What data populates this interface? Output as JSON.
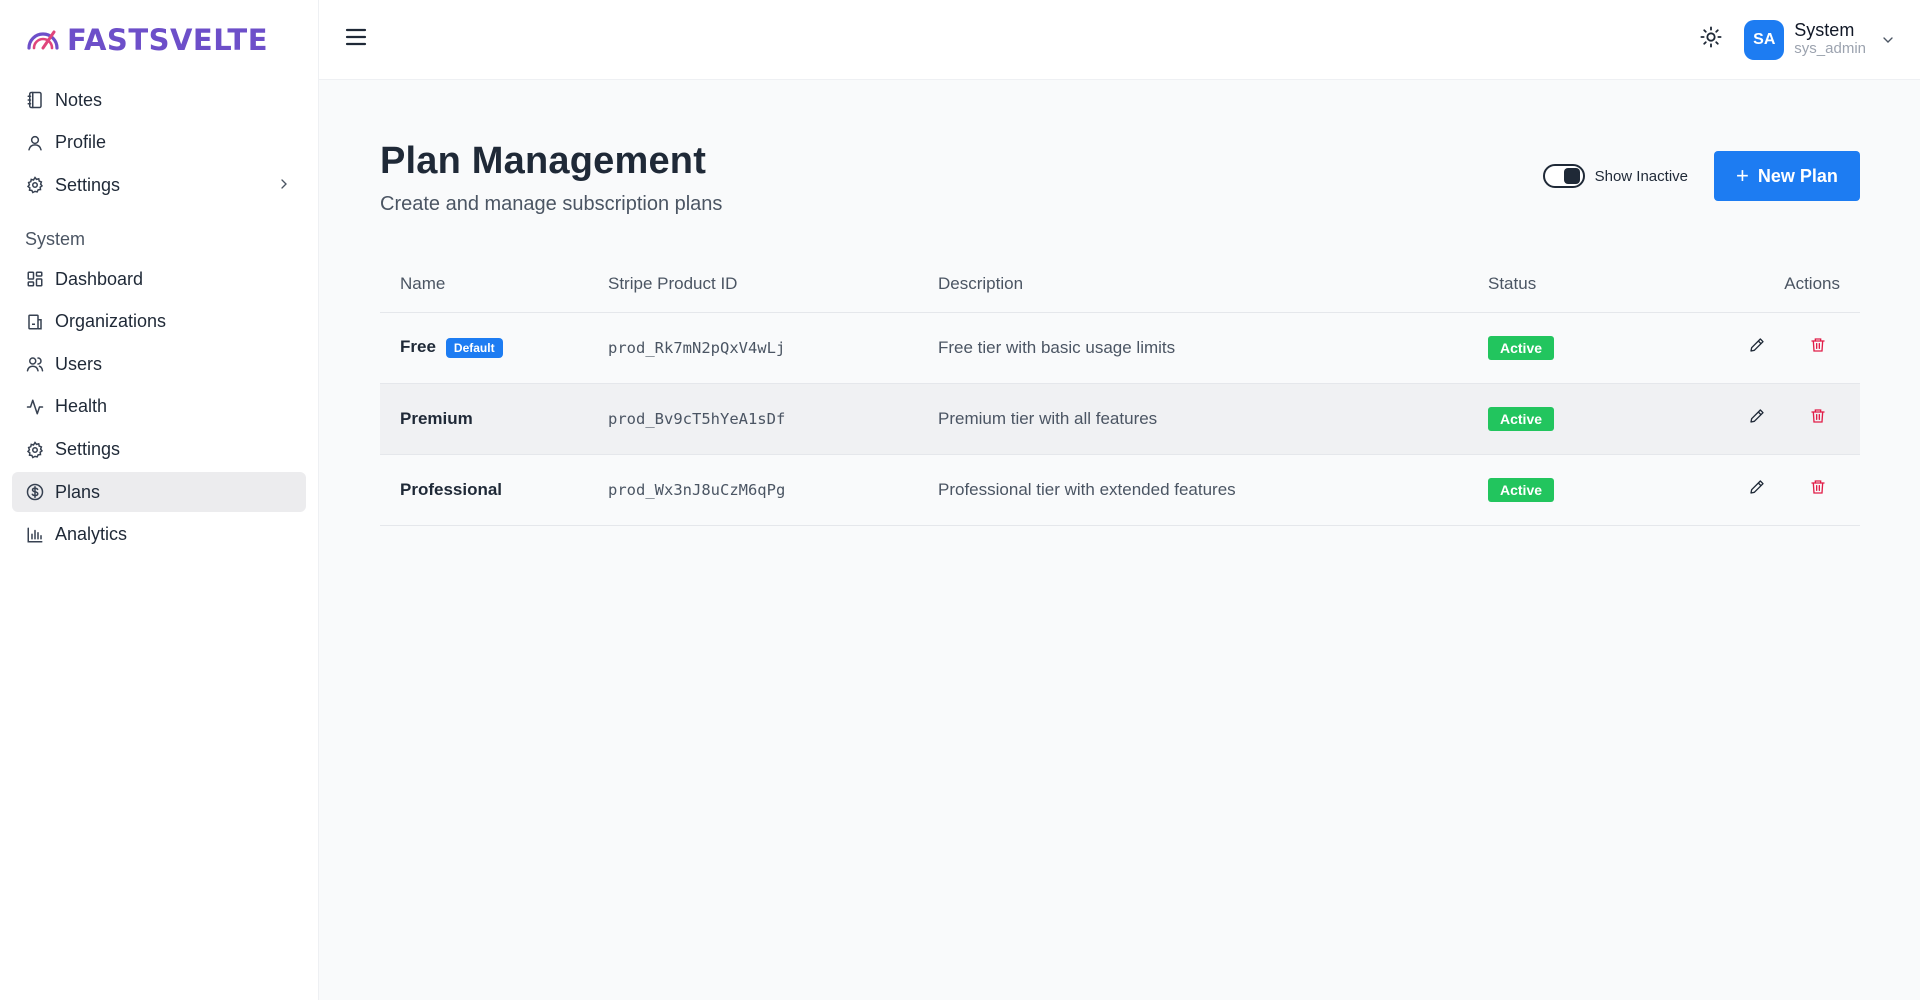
{
  "brand": {
    "name": "FASTSVELTE",
    "color": "#6d4fc9"
  },
  "sidebar": {
    "items": [
      {
        "label": "Notes",
        "icon": "notebook-icon"
      },
      {
        "label": "Profile",
        "icon": "user-icon"
      },
      {
        "label": "Settings",
        "icon": "gear-icon"
      }
    ],
    "section_label": "System",
    "system_items": [
      {
        "label": "Dashboard",
        "icon": "grid-icon"
      },
      {
        "label": "Organizations",
        "icon": "building-icon"
      },
      {
        "label": "Users",
        "icon": "users-icon"
      },
      {
        "label": "Health",
        "icon": "activity-icon"
      },
      {
        "label": "Settings",
        "icon": "gear-icon"
      },
      {
        "label": "Plans",
        "icon": "dollar-circle-icon",
        "active": true
      },
      {
        "label": "Analytics",
        "icon": "bar-chart-icon"
      }
    ]
  },
  "topbar": {
    "user": {
      "initials": "SA",
      "name": "System",
      "handle": "sys_admin"
    },
    "accent": "#1d7cf2"
  },
  "page": {
    "title": "Plan Management",
    "subtitle": "Create and manage subscription plans",
    "toggle_label": "Show Inactive",
    "toggle_on": true,
    "new_button": "New Plan"
  },
  "table": {
    "columns": [
      "Name",
      "Stripe Product ID",
      "Description",
      "Status",
      "Actions"
    ],
    "rows": [
      {
        "name": "Free",
        "badge": "Default",
        "product_id": "prod_Rk7mN2pQxV4wLj",
        "description": "Free tier with basic usage limits",
        "status": "Active"
      },
      {
        "name": "Premium",
        "badge": "",
        "product_id": "prod_Bv9cT5hYeA1sDf",
        "description": "Premium tier with all features",
        "status": "Active"
      },
      {
        "name": "Professional",
        "badge": "",
        "product_id": "prod_Wx3nJ8uCzM6qPg",
        "description": "Professional tier with extended features",
        "status": "Active"
      }
    ]
  },
  "colors": {
    "active_status": "#22c55e",
    "delete": "#e11d48"
  }
}
